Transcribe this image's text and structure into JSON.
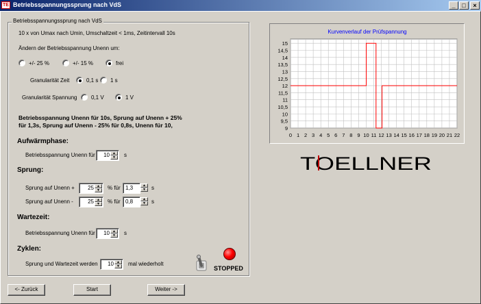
{
  "window": {
    "title": "Betriebsspannungssprung nach VdS",
    "icon_text": "TE"
  },
  "group": {
    "legend": "Betriebsspannungssprung nach VdS",
    "info": "10 x von Umax nach Umin, Umschaltzeit < 1ms, Zeitintervall 10s",
    "change_label": "Ändern der Betriebsspannung Unenn um:",
    "range_options": [
      {
        "label": "+/- 25 %",
        "selected": false
      },
      {
        "label": "+/- 15 %",
        "selected": false
      },
      {
        "label": "frei",
        "selected": true
      }
    ],
    "granularity_time_label": "Granularität Zeit",
    "granularity_time_options": [
      {
        "label": "0,1 s",
        "selected": true
      },
      {
        "label": "1 s",
        "selected": false
      }
    ],
    "granularity_voltage_label": "Granularität Spannung",
    "granularity_voltage_options": [
      {
        "label": "0,1 V",
        "selected": false
      },
      {
        "label": "1 V",
        "selected": true
      }
    ],
    "summary_line1": "Betriebsspannung Unenn für 10s, Sprung auf Unenn + 25%",
    "summary_line2": "für 1,3s, Sprung auf Unenn - 25% für 0,8s, Unenn für 10,"
  },
  "warmup": {
    "heading": "Aufwärmphase:",
    "label": "Betriebsspannung Unenn für",
    "value": "10",
    "unit": "s"
  },
  "jump": {
    "heading": "Sprung:",
    "up_label": "Sprung auf Unenn +",
    "up_percent": "25",
    "up_for": "% für",
    "up_time": "1,3",
    "up_unit": "s",
    "down_label": "Sprung auf Unenn -",
    "down_percent": "25",
    "down_for": "% für",
    "down_time": "0,8",
    "down_unit": "s"
  },
  "wait": {
    "heading": "Wartezeit:",
    "label": "Betriebsspannung Unenn für",
    "value": "10",
    "unit": "s"
  },
  "cycles": {
    "heading": "Zyklen:",
    "label": "Sprung und Wartezeit werden",
    "value": "10",
    "suffix": "mal wiederholt"
  },
  "status": {
    "text": "STOPPED",
    "led_color": "#ff0000"
  },
  "buttons": {
    "back": "<- Zurück",
    "start": "Start",
    "next": "Weiter ->"
  },
  "logo": {
    "text": "TOELLNER",
    "brand_color": "#c00000"
  },
  "chart_data": {
    "type": "line",
    "title": "Kurvenverlauf der Prüfspannung",
    "x_ticks": [
      "0",
      "1",
      "2",
      "3",
      "4",
      "5",
      "6",
      "7",
      "8",
      "9",
      "10",
      "11",
      "12",
      "13",
      "14",
      "15",
      "16",
      "17",
      "18",
      "19",
      "20",
      "21",
      "22"
    ],
    "y_ticks": [
      "15",
      "14,5",
      "14",
      "13,5",
      "13",
      "12,5",
      "12",
      "11,5",
      "11",
      "10,5",
      "10",
      "9,5",
      "9"
    ],
    "xlim": [
      0,
      22
    ],
    "ylim": [
      9,
      15.3
    ],
    "grid": true,
    "line_color": "#ff0000",
    "series": [
      {
        "x": [
          0,
          10,
          10,
          11.3,
          11.3,
          12.1,
          12.1,
          22
        ],
        "y": [
          12,
          12,
          15,
          15,
          9,
          9,
          12,
          12
        ]
      }
    ]
  }
}
